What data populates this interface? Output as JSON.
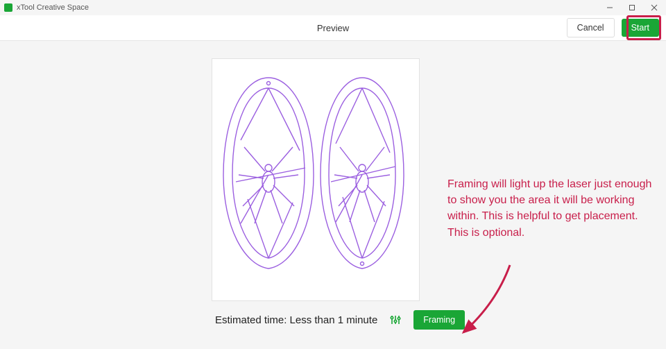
{
  "window": {
    "title": "xTool Creative Space"
  },
  "toolbar": {
    "title": "Preview",
    "cancel_label": "Cancel",
    "start_label": "Start"
  },
  "status": {
    "estimated_label": "Estimated time: Less than 1 minute",
    "framing_label": "Framing"
  },
  "annotation": {
    "text": "Framing will light up the laser just enough to show you the area it will be working within. This is helpful to get placement. This is optional."
  },
  "colors": {
    "accent_green": "#1aa636",
    "annotation_red": "#c81e4a",
    "preview_stroke": "#9b5fe0"
  }
}
